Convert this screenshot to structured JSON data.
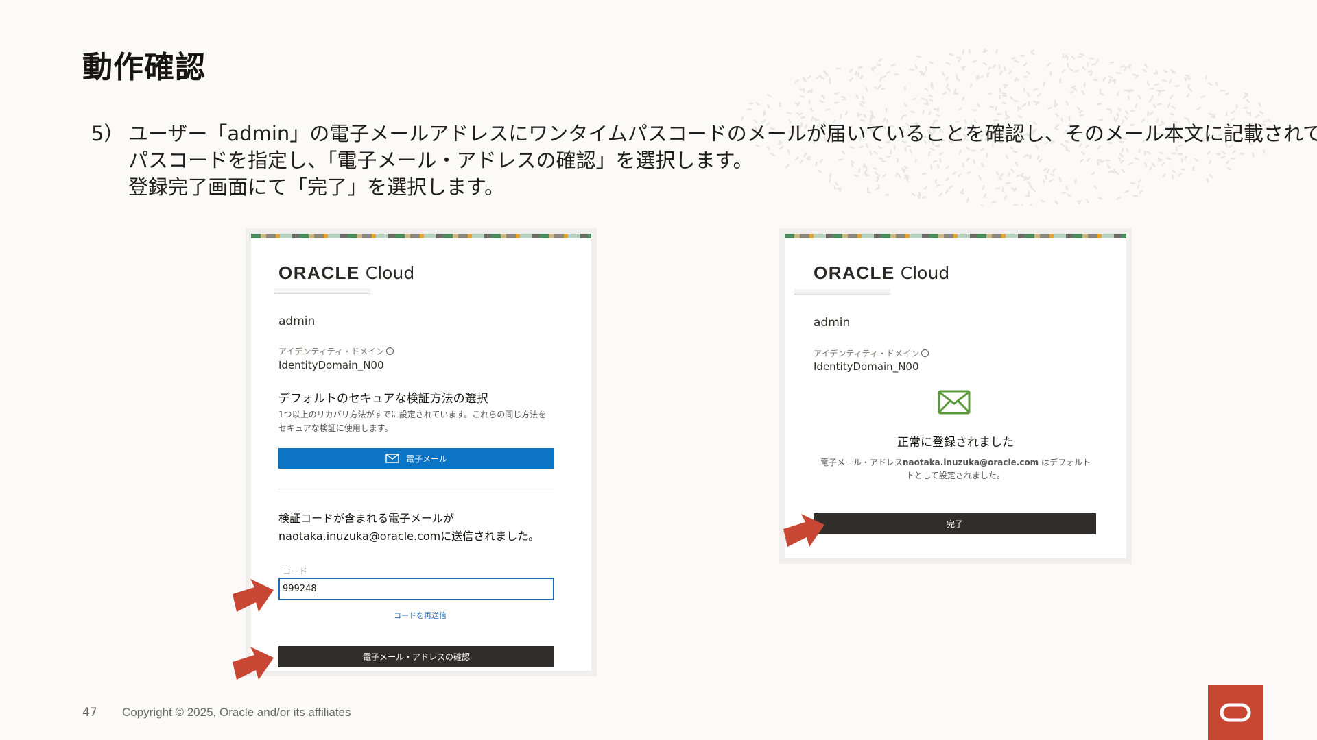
{
  "slide": {
    "title": "動作確認",
    "step_number": "5）",
    "instruction_lines": [
      "ユーザー「admin」の電子メールアドレスにワンタイムパスコードのメールが届いていることを確認し、そのメール本文に記載されている",
      "パスコードを指定し、「電子メール・アドレスの確認」を選択します。",
      "登録完了画面にて「完了」を選択します。"
    ],
    "page_number": "47",
    "copyright": "Copyright © 2025, Oracle and/or its affiliates"
  },
  "left_screen": {
    "logo_brand": "ORACLE",
    "logo_product": "Cloud",
    "username": "admin",
    "domain_label": "アイデンティティ・ドメイン",
    "domain_value": "IdentityDomain_N00",
    "section_heading": "デフォルトのセキュアな検証方法の選択",
    "section_desc": "1つ以上のリカバリ方法がすでに設定されています。これらの同じ方法をセキュアな検証に使用します。",
    "email_button_label": "電子メール",
    "sent_line1": "検証コードが含まれる電子メールが",
    "sent_line2": "naotaka.inuzuka@oracle.comに送信されました。",
    "code_label": "コード",
    "code_value": "999248",
    "resend_link": "コードを再送信",
    "verify_button_label": "電子メール・アドレスの確認"
  },
  "right_screen": {
    "logo_brand": "ORACLE",
    "logo_product": "Cloud",
    "username": "admin",
    "domain_label": "アイデンティティ・ドメイン",
    "domain_value": "IdentityDomain_N00",
    "success_title": "正常に登録されました",
    "success_prefix": "電子メール・アドレス",
    "success_email": "naotaka.inuzuka@oracle.com",
    "success_suffix": " はデフォルト",
    "success_line2": "トとして設定されました。",
    "done_button_label": "完了"
  },
  "colors": {
    "accent_blue": "#0b74c4",
    "dark_button": "#312d2a",
    "arrow_red": "#c74634",
    "success_green": "#5a9a3a",
    "oracle_red": "#c74634"
  },
  "icons": {
    "email_button_icon": "envelope-icon",
    "success_icon": "envelope-icon",
    "info_icon": "info-icon",
    "oracle_corner_logo": "oracle-o-logo"
  }
}
